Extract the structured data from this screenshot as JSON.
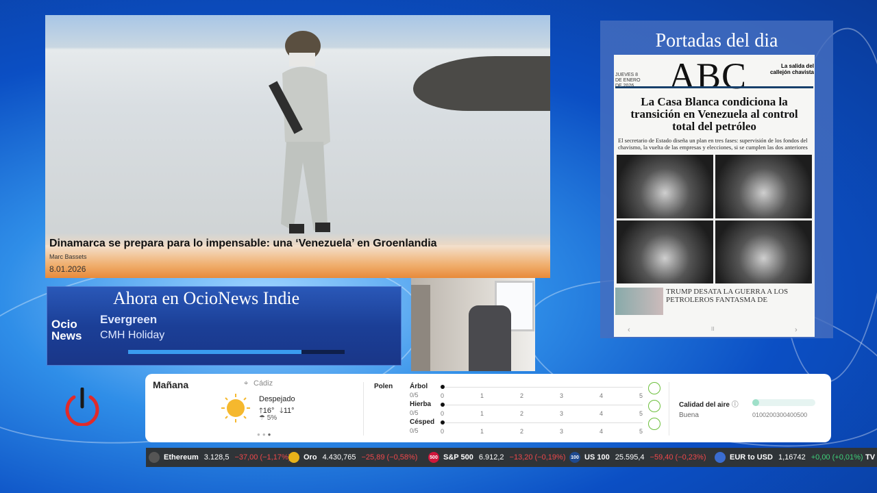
{
  "news": {
    "headline": "Dinamarca se prepara para lo impensable: una ‘Venezuela’ en Groenlandia",
    "author": "Marc Bassets",
    "date": "8.01.2026"
  },
  "player": {
    "title": "Ahora en OcioNews Indie",
    "logo_line1": "Ocio",
    "logo_line2": "News",
    "track": "Evergreen",
    "artist": "CMH Holiday",
    "progress": 0.8
  },
  "front_page": {
    "heading": "Portadas del dia",
    "masthead": "ABC",
    "masthead_side": "La salida del callejón chavista",
    "date_box": "JUEVES 8 DE ENERO DE 2026",
    "title": "La Casa Blanca condiciona la transición en Venezuela al control total del petróleo",
    "subtitle": "El secretario de Estado diseña un plan en tres fases: supervisión de los fondos del chavismo, la vuelta de las empresas y elecciones, si se cumplen las dos anteriores",
    "teaser": "TRUMP DESATA LA GUERRA A LOS PETROLEROS FANTASMA DE",
    "nav_prev": "‹",
    "nav_pause": "II",
    "nav_next": "›"
  },
  "weather": {
    "day": "Mañana",
    "location": "Cádiz",
    "condition": "Despejado",
    "high": "16°",
    "low": "11°",
    "rain": "5%",
    "pollen_label": "Polen",
    "pollen": [
      {
        "name": "Árbol",
        "level": "0/5"
      },
      {
        "name": "Hierba",
        "level": "0/5"
      },
      {
        "name": "Césped",
        "level": "0/5"
      }
    ],
    "scale": [
      "0",
      "1",
      "2",
      "3",
      "4",
      "5"
    ],
    "air_label": "Calidad del aire",
    "air_value": "Buena",
    "air_scale": "0100200300400500",
    "icon": "sun-icon",
    "colors": {
      "sun": "#f5b82e",
      "pollen_icon": "#6bbf3a"
    }
  },
  "ticker": [
    {
      "name": "Ethereum",
      "value": "3.128,5",
      "change": "−37,00 (−1,17%)",
      "dir": "down",
      "icon": "ethereum-icon"
    },
    {
      "name": "Oro",
      "value": "4.430,765",
      "change": "−25,89 (−0,58%)",
      "dir": "down",
      "icon": "gold-icon"
    },
    {
      "name": "S&P 500",
      "value": "6.912,2",
      "change": "−13,20 (−0,19%)",
      "dir": "down",
      "icon": "sp500-icon",
      "badge": "500"
    },
    {
      "name": "US 100",
      "value": "25.595,4",
      "change": "−59,40 (−0,23%)",
      "dir": "down",
      "icon": "us100-icon",
      "badge": "100"
    },
    {
      "name": "EUR to USD",
      "value": "1,16742",
      "change": "+0,00 (+0,01%)",
      "dir": "up",
      "icon": "eurusd-icon"
    }
  ],
  "ticker_brand": "TV"
}
